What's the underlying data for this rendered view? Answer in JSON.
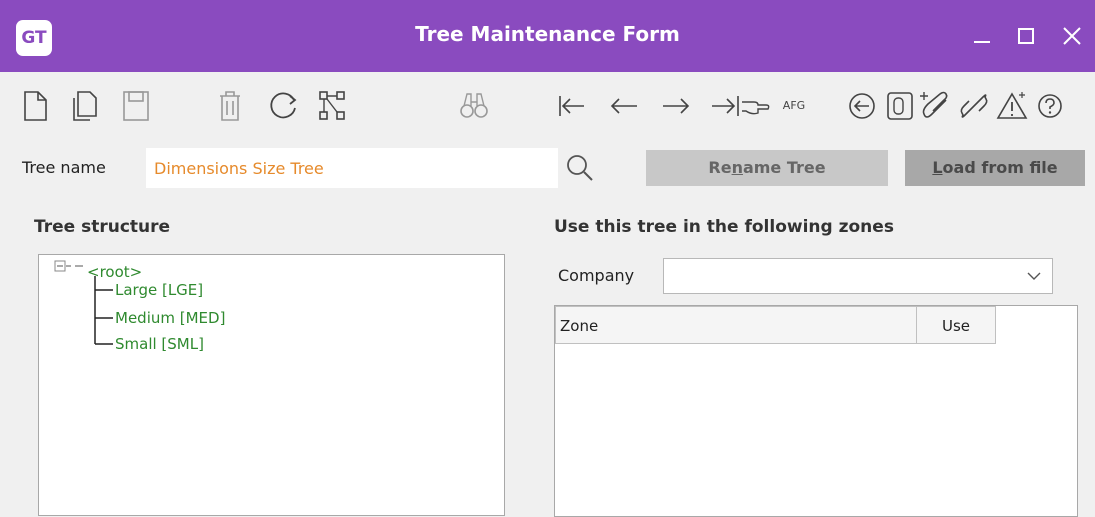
{
  "window": {
    "logo": "GT",
    "title": "Tree Maintenance Form"
  },
  "toolbar": {
    "icons": [
      "new-document-icon",
      "copy-icon",
      "save-icon",
      "delete-icon",
      "refresh-icon",
      "tree-structure-icon",
      "binoculars-icon",
      "first-record-icon",
      "previous-record-icon",
      "next-record-icon",
      "last-record-icon",
      "afg-label",
      "back-circle-icon",
      "notes-icon",
      "attach-icon",
      "link-icon",
      "alert-icon",
      "help-icon"
    ],
    "afg_label": "AFG"
  },
  "tree_name": {
    "label": "Tree name",
    "value": "Dimensions Size Tree"
  },
  "buttons": {
    "rename_pre": "Re",
    "rename_underline": "n",
    "rename_post": "ame Tree",
    "load_underline": "L",
    "load_post": "oad from file"
  },
  "tree_structure": {
    "title": "Tree structure",
    "root": "<root>",
    "children": [
      "Large [LGE]",
      "Medium [MED]",
      "Small [SML]"
    ]
  },
  "zones": {
    "title": "Use this tree in the following zones",
    "company_label": "Company",
    "company_value": "",
    "columns": [
      "Zone",
      "Use"
    ]
  }
}
